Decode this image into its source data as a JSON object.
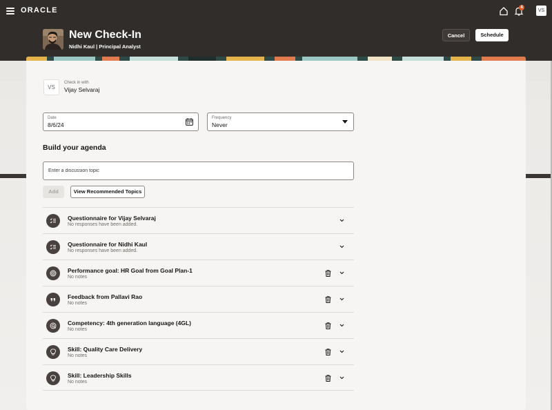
{
  "header": {
    "brand": "ORACLE",
    "notification_count": "4",
    "user_initials": "VS",
    "title": "New Check-In",
    "subtitle": "Nidhi Kaul | Principal Analyst",
    "cancel_label": "Cancel",
    "schedule_label": "Schedule"
  },
  "checkin": {
    "initials": "VS",
    "label": "Check in with",
    "name": "Vijay Selvaraj"
  },
  "date_field": {
    "label": "Date",
    "value": "8/6/24"
  },
  "frequency_field": {
    "label": "Frequency",
    "value": "Never"
  },
  "agenda": {
    "title": "Build your agenda",
    "topic_placeholder": "Enter a discussion topic",
    "add_label": "Add",
    "recommended_label": "View Recommended Topics",
    "items": [
      {
        "title": "Questionnaire for Vijay Selvaraj",
        "subtitle": "No responses have been added.",
        "icon": "questionnaire-icon",
        "deletable": false
      },
      {
        "title": "Questionnaire for Nidhi Kaul",
        "subtitle": "No responses have been added.",
        "icon": "questionnaire-icon",
        "deletable": false
      },
      {
        "title": "Performance goal: HR Goal from Goal Plan-1",
        "subtitle": "No notes",
        "icon": "target-icon",
        "deletable": true
      },
      {
        "title": "Feedback from Pallavi Rao",
        "subtitle": "No notes",
        "icon": "quote-icon",
        "deletable": true
      },
      {
        "title": "Competency: 4th generation language (4GL)",
        "subtitle": "No notes",
        "icon": "competency-icon",
        "deletable": true
      },
      {
        "title": "Skill: Quality Care Delivery",
        "subtitle": "No notes",
        "icon": "lightbulb-icon",
        "deletable": true
      },
      {
        "title": "Skill: Leadership Skills",
        "subtitle": "No notes",
        "icon": "lightbulb-icon",
        "deletable": true
      }
    ]
  },
  "colors": {
    "header_bg": "#312d2a",
    "card_bg": "#f6f5f3",
    "notification_badge": "#e05d2b",
    "icon_circle": "#48413e"
  }
}
